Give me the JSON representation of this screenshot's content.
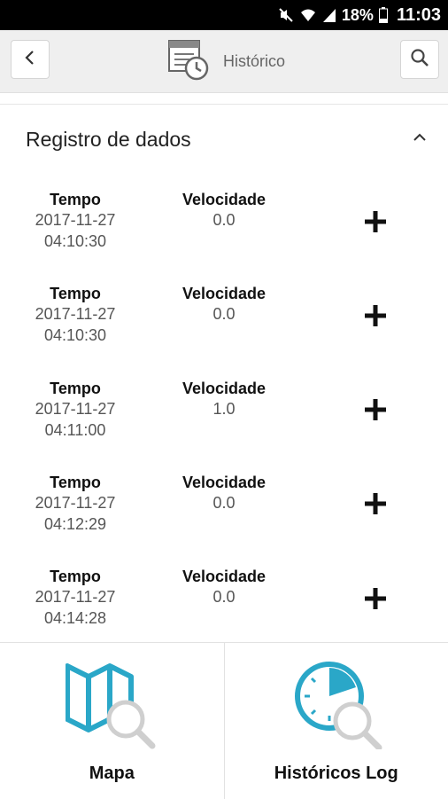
{
  "status_bar": {
    "battery": "18%",
    "time": "11:03",
    "icons": [
      "mute-icon",
      "wifi-icon",
      "signal-icon",
      "battery-icon"
    ]
  },
  "header": {
    "title": "Histórico",
    "back_icon": "chevron-left-icon",
    "search_icon": "search-icon",
    "title_icon": "history-document-icon"
  },
  "section": {
    "title": "Registro de dados",
    "collapse_icon": "chevron-up-icon"
  },
  "records": [
    {
      "time_label": "Tempo",
      "date": "2017-11-27",
      "time": "04:10:30",
      "speed_label": "Velocidade",
      "speed": "0.0"
    },
    {
      "time_label": "Tempo",
      "date": "2017-11-27",
      "time": "04:10:30",
      "speed_label": "Velocidade",
      "speed": "0.0"
    },
    {
      "time_label": "Tempo",
      "date": "2017-11-27",
      "time": "04:11:00",
      "speed_label": "Velocidade",
      "speed": "1.0"
    },
    {
      "time_label": "Tempo",
      "date": "2017-11-27",
      "time": "04:12:29",
      "speed_label": "Velocidade",
      "speed": "0.0"
    },
    {
      "time_label": "Tempo",
      "date": "2017-11-27",
      "time": "04:14:28",
      "speed_label": "Velocidade",
      "speed": "0.0"
    }
  ],
  "bottom_nav": {
    "map_label": "Mapa",
    "history_label": "Históricos Log"
  },
  "colors": {
    "accent": "#2aa7c8",
    "appbar_bg": "#efefef",
    "statusbar_bg": "#000000"
  }
}
